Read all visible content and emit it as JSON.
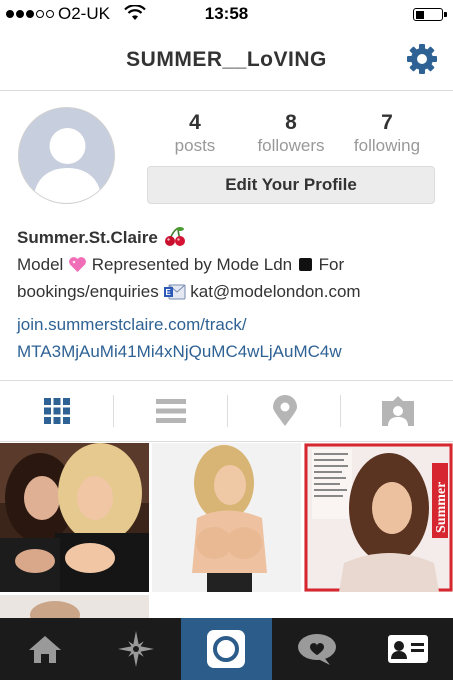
{
  "status_bar": {
    "carrier": "O2-UK",
    "time": "13:58",
    "signal_bars_filled": 3,
    "signal_bars_total": 5
  },
  "header": {
    "title": "SUMMER__LoVING",
    "settings_icon": "gear-icon",
    "accent": "#2f6294"
  },
  "profile": {
    "stats": [
      {
        "value": "4",
        "label": "posts"
      },
      {
        "value": "8",
        "label": "followers"
      },
      {
        "value": "7",
        "label": "following"
      }
    ],
    "edit_button": "Edit Your Profile",
    "name": "Summer.St.Claire",
    "bio_model": "Model",
    "bio_represented": "Represented by Mode Ldn",
    "bio_for": "For",
    "bio_bookings": "bookings/enquiries",
    "bio_email": "kat@modelondon.com",
    "link_line1": "join.summerstclaire.com/track/",
    "link_line2": "MTA3MjAuMi41Mi4xNjQuMC4wLjAuMC4w"
  },
  "view_tabs": [
    "grid-icon",
    "list-icon",
    "location-icon",
    "tagged-icon"
  ],
  "bottom_tabs": [
    "home-icon",
    "explore-icon",
    "camera-icon",
    "activity-icon",
    "profile-icon"
  ],
  "photos": [
    {
      "id": "photo-1"
    },
    {
      "id": "photo-2"
    },
    {
      "id": "photo-3",
      "magazine_text": "Summer"
    }
  ]
}
